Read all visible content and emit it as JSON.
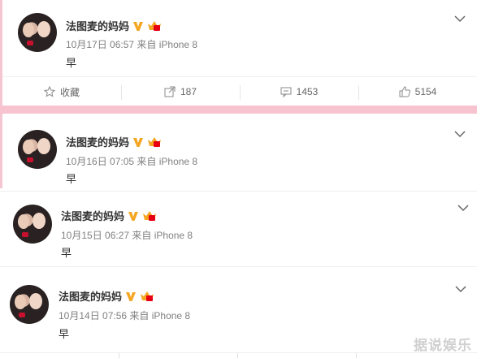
{
  "posts": [
    {
      "author": "法图麦的妈妈",
      "meta": "10月17日 06:57 来自 iPhone 8",
      "text": "早"
    },
    {
      "author": "法图麦的妈妈",
      "meta": "10月16日 07:05 来自 iPhone 8",
      "text": "早"
    },
    {
      "author": "法图麦的妈妈",
      "meta": "10月15日 06:27 来自 iPhone 8",
      "text": "早"
    },
    {
      "author": "法图麦的妈妈",
      "meta": "10月14日 07:56 来自 iPhone 8",
      "text": "早"
    }
  ],
  "actions": {
    "favorite": "收藏",
    "repost": "187",
    "comment": "1453",
    "like": "5154"
  },
  "watermark": "据说娱乐",
  "colors": {
    "accent_pink": "#f7c3cf",
    "vip_badge": "#f5a623",
    "text_meta": "#808080"
  },
  "icons": {
    "verified": "v-badge-icon",
    "member": "crown-icon",
    "menu": "chevron-down-icon"
  }
}
